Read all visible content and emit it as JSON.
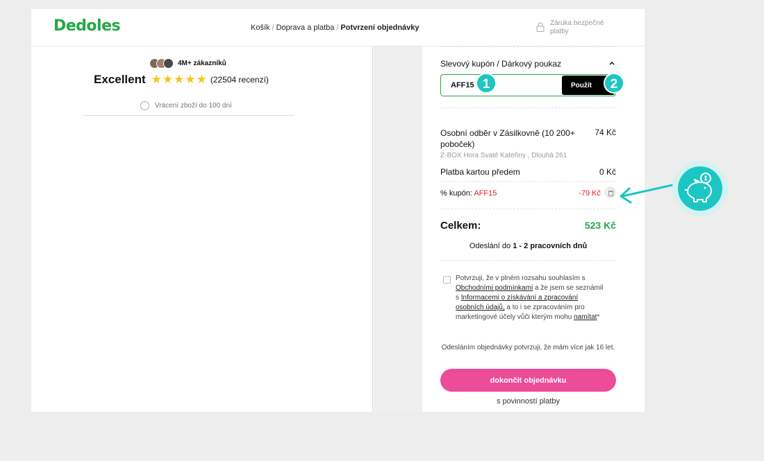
{
  "header": {
    "logo": "Dedoles",
    "breadcrumb": {
      "step1": "Košík",
      "step2": "Doprava a platba",
      "step3": "Potvrzení objednávky",
      "separator": "/"
    },
    "secure_payment": "Záruka bezpečné platby",
    "lock_icon": "lock-icon"
  },
  "trust": {
    "customers": "4M+ zákazníků",
    "rating_label": "Excellent",
    "stars": "★★★★★",
    "reviews": "(22504 recenzí)",
    "returns": "Vrácení zboží do 100 dní"
  },
  "coupon": {
    "title": "Slevový kupón / Dárkový poukaz",
    "value": "AFF15",
    "apply_label": "Použít",
    "step1_badge": "1",
    "step2_badge": "2"
  },
  "summary": {
    "shipping_name": "Osobní odběr v Zásilkovně (10 200+ poboček)",
    "shipping_price": "74 Kč",
    "shipping_address": "Z-BOX Hora Svaté Kateřiny , Dlouhá 261",
    "payment_name": "Platba kartou předem",
    "payment_price": "0 Kč",
    "coupon_label": "% kupón:",
    "coupon_code": "AFF15",
    "coupon_discount": "-79 Kč",
    "total_label": "Celkem:",
    "total_value": "523 Kč",
    "dispatch_prefix": "Odeslání do",
    "dispatch_bold": "1 - 2 pracovních dnů"
  },
  "consent": {
    "t1": "Potvrzuji, že v plném rozsahu souhlasím s",
    "link1": "Obchodními podmínkami",
    "t2": "a že jsem se seznámil s",
    "link2": "Informacemi o získávání a zpracování osobních údajů,",
    "t3": "a to i se zpracováním pro marketingové účely vůči kterým mohu",
    "link3": "namítat",
    "t4": "*"
  },
  "age_note": "Odesláním objednávky potvrzuji, že mám více jak 16 let.",
  "finish_button": "dokončit objednávku",
  "obligation": "s povinností platby",
  "colors": {
    "brand_green": "#23a845",
    "accent_pink": "#ec4c98",
    "teal": "#1cc6c4",
    "discount_red": "#e32222"
  }
}
